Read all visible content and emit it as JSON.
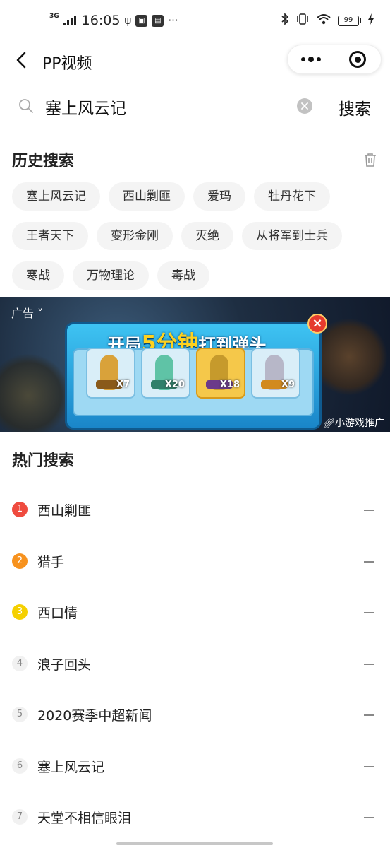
{
  "status_bar": {
    "network": "3G",
    "time": "16:05",
    "battery": "99",
    "more_dots": "···"
  },
  "nav": {
    "title": "PP视频"
  },
  "search": {
    "query": "塞上风云记",
    "button_label": "搜索"
  },
  "history": {
    "title": "历史搜索",
    "rows": [
      [
        "塞上风云记",
        "西山剿匪",
        "爱玛",
        "牡丹花下"
      ],
      [
        "王者天下",
        "变形金刚",
        "灭绝",
        "从将军到士兵"
      ],
      [
        "寒战",
        "万物理论",
        "毒战"
      ]
    ]
  },
  "ad": {
    "label": "广告",
    "headline_prefix": "开局",
    "headline_highlight": "5分钟",
    "headline_suffix": "打到弹头",
    "items": [
      {
        "qty": "X7",
        "color": "#d9a23a"
      },
      {
        "qty": "X20",
        "color": "#5fc3a6"
      },
      {
        "qty": "X18",
        "color": "#c69a2c"
      },
      {
        "qty": "X9",
        "color": "#b7b7c8"
      }
    ],
    "promo": "小游戏推广"
  },
  "hot": {
    "title": "热门搜索",
    "items": [
      {
        "rank": "1",
        "label": "西山剿匪"
      },
      {
        "rank": "2",
        "label": "猎手"
      },
      {
        "rank": "3",
        "label": "西口情"
      },
      {
        "rank": "4",
        "label": "浪子回头"
      },
      {
        "rank": "5",
        "label": "2020赛季中超新闻"
      },
      {
        "rank": "6",
        "label": "塞上风云记"
      },
      {
        "rank": "7",
        "label": "天堂不相信眼泪"
      }
    ]
  },
  "colors": {
    "rank1": "#ef4b3f",
    "rank2": "#f7921e",
    "rank3": "#f5d000"
  }
}
